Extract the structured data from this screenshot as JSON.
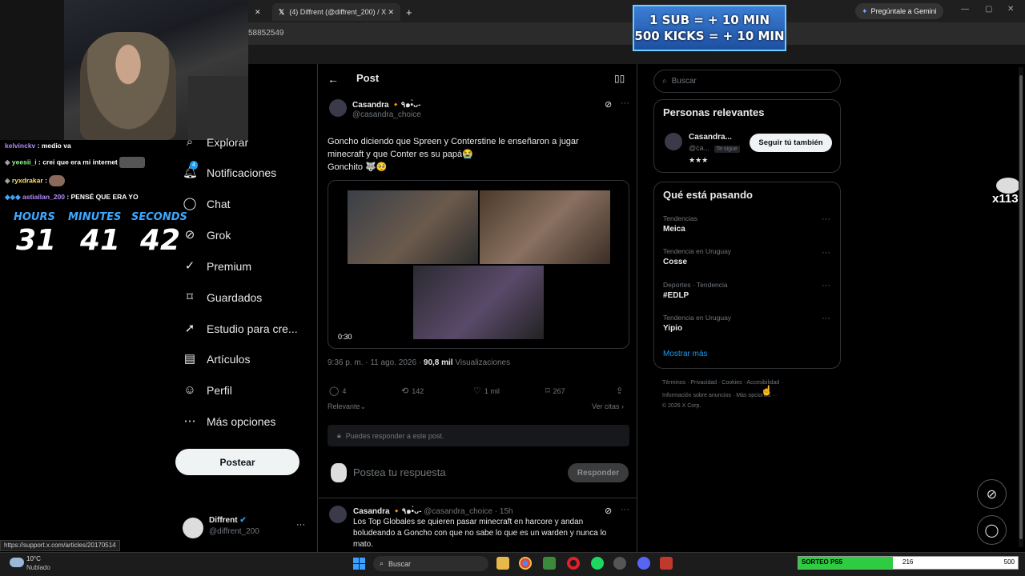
{
  "browser": {
    "tab_title": "(4) Diffrent (@diffrent_200) / X",
    "address_fragment": "58852549",
    "gemini_label": "Pregúntale a Gemini"
  },
  "banner": {
    "line1": "1 SUB = + 10 MIN",
    "line2": "500 KICKS = + 10 MIN"
  },
  "stream_chat": [
    {
      "user": "kelvinckv",
      "text": ": medio va",
      "color": "#b48cff"
    },
    {
      "user": "yeesii_i",
      "text": ": crei que era mi internet",
      "color": "#8cff8c"
    },
    {
      "user": "ryxdrakar",
      "text": ":",
      "color": "#ffe066"
    },
    {
      "user": "astiallan_200",
      "text": ": PENSÉ QUE ERA YO",
      "color": "#b48cff"
    }
  ],
  "timer": {
    "hours_label": "HOURS",
    "minutes_label": "MINUTES",
    "seconds_label": "SECONDS",
    "hours": "31",
    "minutes": "41",
    "seconds": "42"
  },
  "nav": {
    "items": [
      {
        "label": "Explorar",
        "icon": "search-icon"
      },
      {
        "label": "Notificaciones",
        "icon": "bell-icon"
      },
      {
        "label": "Chat",
        "icon": "chat-icon"
      },
      {
        "label": "Grok",
        "icon": "grok-icon"
      },
      {
        "label": "Premium",
        "icon": "premium-icon"
      },
      {
        "label": "Guardados",
        "icon": "bookmark-icon"
      },
      {
        "label": "Estudio para cre...",
        "icon": "rocket-icon"
      },
      {
        "label": "Artículos",
        "icon": "article-icon"
      },
      {
        "label": "Perfil",
        "icon": "person-icon"
      },
      {
        "label": "Más opciones",
        "icon": "more-icon"
      }
    ],
    "notif_badge": "4",
    "post_button": "Postear",
    "account_name": "Diffrent",
    "account_handle": "@diffrent_200"
  },
  "post": {
    "header": "Post",
    "author_name": "Casandra 🔸٩๑•̀ᴗ-",
    "author_handle": "@casandra_choice",
    "text_line1": "Goncho diciendo que Spreen y Conterstine le enseñaron a jugar",
    "text_line2": "minecraft y que Conter es su papá😭",
    "text_line3": "Gonchito 🐺🥺",
    "video_time": "0:30",
    "timestamp": "9:36 p. m. · 11 ago. 2026 ·",
    "views_count": "90,8 mil",
    "views_label": "Visualizaciones",
    "replies": "4",
    "reposts": "142",
    "likes": "1 mil",
    "bookmarks": "267",
    "sort_label": "Relevante",
    "quotes_label": "Ver citas",
    "reply_notice": "Puedes responder a este post.",
    "reply_placeholder": "Postea tu respuesta",
    "reply_button": "Responder"
  },
  "reply": {
    "author_name": "Casandra 🔸٩๑•̀ᴗ-",
    "meta": "@casandra_choice · 15h",
    "line1": "Los Top Globales se quieren pasar minecraft en harcore y andan",
    "line2": "boludeando a Goncho con que no sabe lo que es un warden y nunca lo",
    "line3": "mato."
  },
  "sidebar": {
    "search_placeholder": "Buscar",
    "relevant_title": "Personas relevantes",
    "relevant_name": "Casandra...",
    "relevant_handle": "@ca...",
    "follows_you": "Te sigue",
    "follow_back": "Seguir tú también",
    "stars": "★★★",
    "trending_title": "Qué está pasando",
    "trends": [
      {
        "label": "Tendencias",
        "name": "Meica"
      },
      {
        "label": "Tendencia en Uruguay",
        "name": "Cosse"
      },
      {
        "label": "Deportes · Tendencia",
        "name": "#EDLP"
      },
      {
        "label": "Tendencia en Uruguay",
        "name": "Yipio"
      }
    ],
    "show_more": "Mostrar más",
    "footer1": "Términos  ·  Privacidad  ·  Cookies  ·  Accesibilidad  ·",
    "footer2": "Información sobre anuncios  ·  Más opciones ···",
    "footer3": "© 2026 X Corp."
  },
  "overlay": {
    "multiplier": "x113"
  },
  "statusbar": {
    "url": "https://support.x.com/articles/20170514"
  },
  "taskbar": {
    "weather_temp": "10°C",
    "weather_desc": "Nublado",
    "search_label": "Buscar",
    "goal_label": "SORTEO PS5",
    "goal_current": "216",
    "goal_target": "500",
    "goal_progress": 0.432
  }
}
